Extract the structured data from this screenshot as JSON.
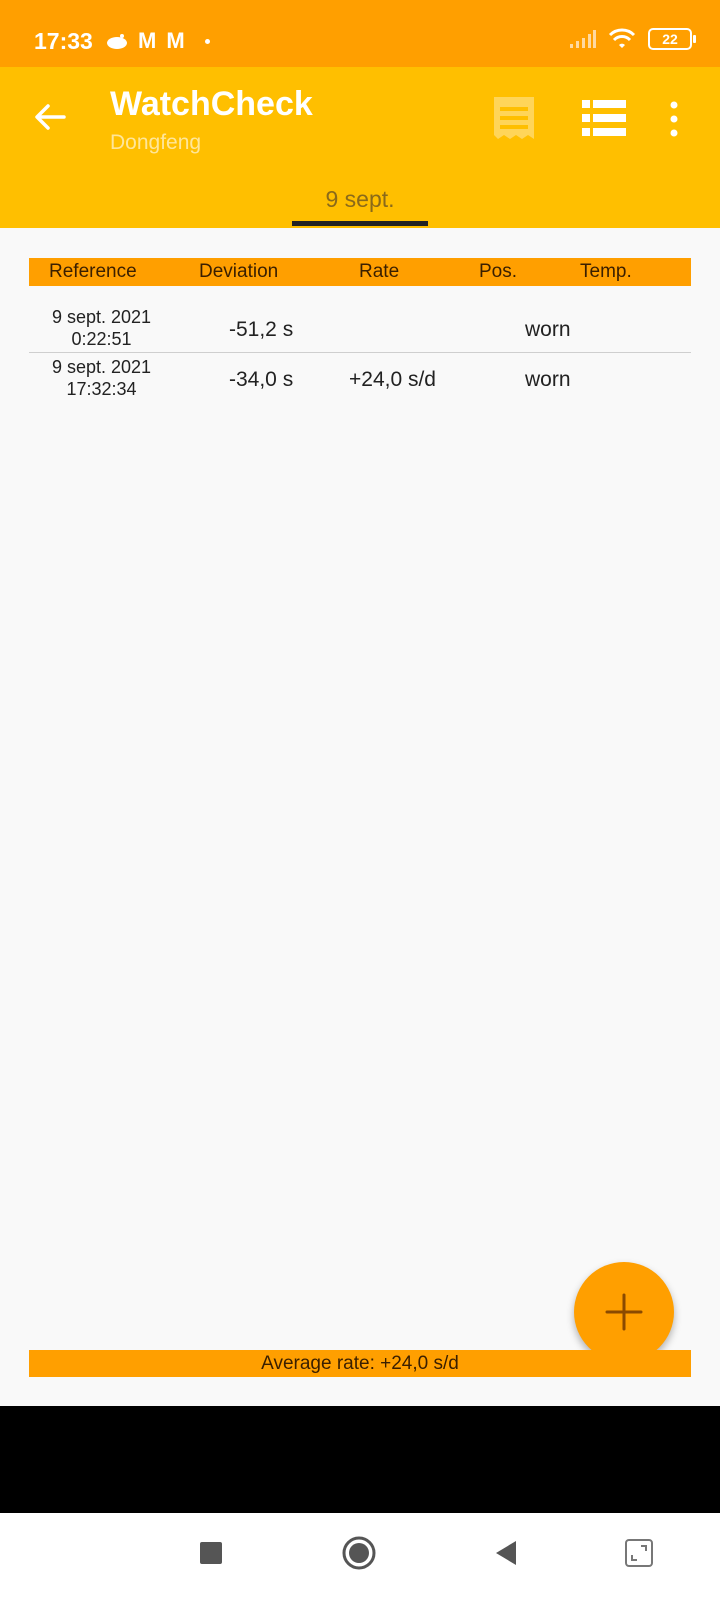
{
  "status_bar": {
    "time": "17:33",
    "notification_icons": [
      "reddit-icon",
      "gmail-icon",
      "gmail-icon",
      "dot-icon"
    ],
    "battery": "22"
  },
  "toolbar": {
    "title": "WatchCheck",
    "subtitle": "Dongfeng"
  },
  "tabs": [
    {
      "label": "9 sept.",
      "selected": true
    }
  ],
  "table": {
    "headers": [
      "Reference",
      "Deviation",
      "Rate",
      "Pos.",
      "Temp."
    ],
    "rows": [
      {
        "date": "9 sept. 2021",
        "time": "0:22:51",
        "deviation": "-51,2 s",
        "rate": "",
        "position": "worn",
        "temp": ""
      },
      {
        "date": "9 sept. 2021",
        "time": "17:32:34",
        "deviation": "-34,0 s",
        "rate": "+24,0 s/d",
        "position": "worn",
        "temp": ""
      }
    ]
  },
  "footer": {
    "average_rate": "Average rate: +24,0 s/d"
  },
  "colors": {
    "status_bar": "#ff9f00",
    "toolbar": "#ffbf00",
    "accent": "#ff9f00"
  }
}
